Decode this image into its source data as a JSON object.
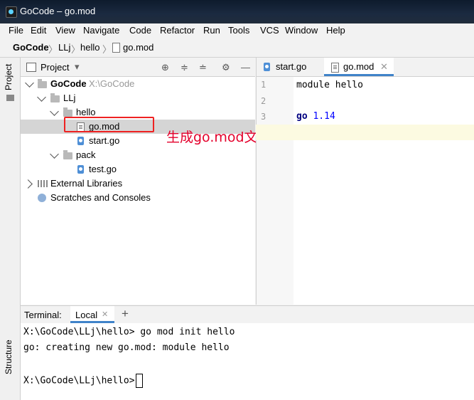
{
  "window": {
    "title": "GoCode – go.mod"
  },
  "menu": [
    "File",
    "Edit",
    "View",
    "Navigate",
    "Code",
    "Refactor",
    "Run",
    "Tools",
    "VCS",
    "Window",
    "Help"
  ],
  "breadcrumb": {
    "root": "GoCode",
    "p1": "LLj",
    "p2": "hello",
    "file": "go.mod"
  },
  "stripe": {
    "project": "Project",
    "structure": "Structure"
  },
  "project_panel": {
    "label": "Project"
  },
  "tree": {
    "root": {
      "name": "GoCode",
      "path": "X:\\GoCode"
    },
    "llj": "LLj",
    "hello": "hello",
    "gomod": "go.mod",
    "startgo": "start.go",
    "pack": "pack",
    "testgo": "test.go",
    "external": "External Libraries",
    "scratches": "Scratches and Consoles"
  },
  "annotation": "生成go.mod文件",
  "editor_tabs": [
    {
      "label": "start.go"
    },
    {
      "label": "go.mod"
    }
  ],
  "editor": {
    "line_numbers": [
      "1",
      "2",
      "3"
    ],
    "line1": {
      "kw": "module",
      "rest": " hello"
    },
    "line3": {
      "kw": "go",
      "num": " 1.14"
    }
  },
  "terminal": {
    "label": "Terminal:",
    "tab": "Local",
    "lines": [
      "X:\\GoCode\\LLj\\hello> go mod init hello",
      "go: creating new go.mod: module hello",
      "",
      "X:\\GoCode\\LLj\\hello>"
    ]
  },
  "colors": {
    "annotation": "#e4002b",
    "keyword": "#000080",
    "number": "#0000ff"
  }
}
